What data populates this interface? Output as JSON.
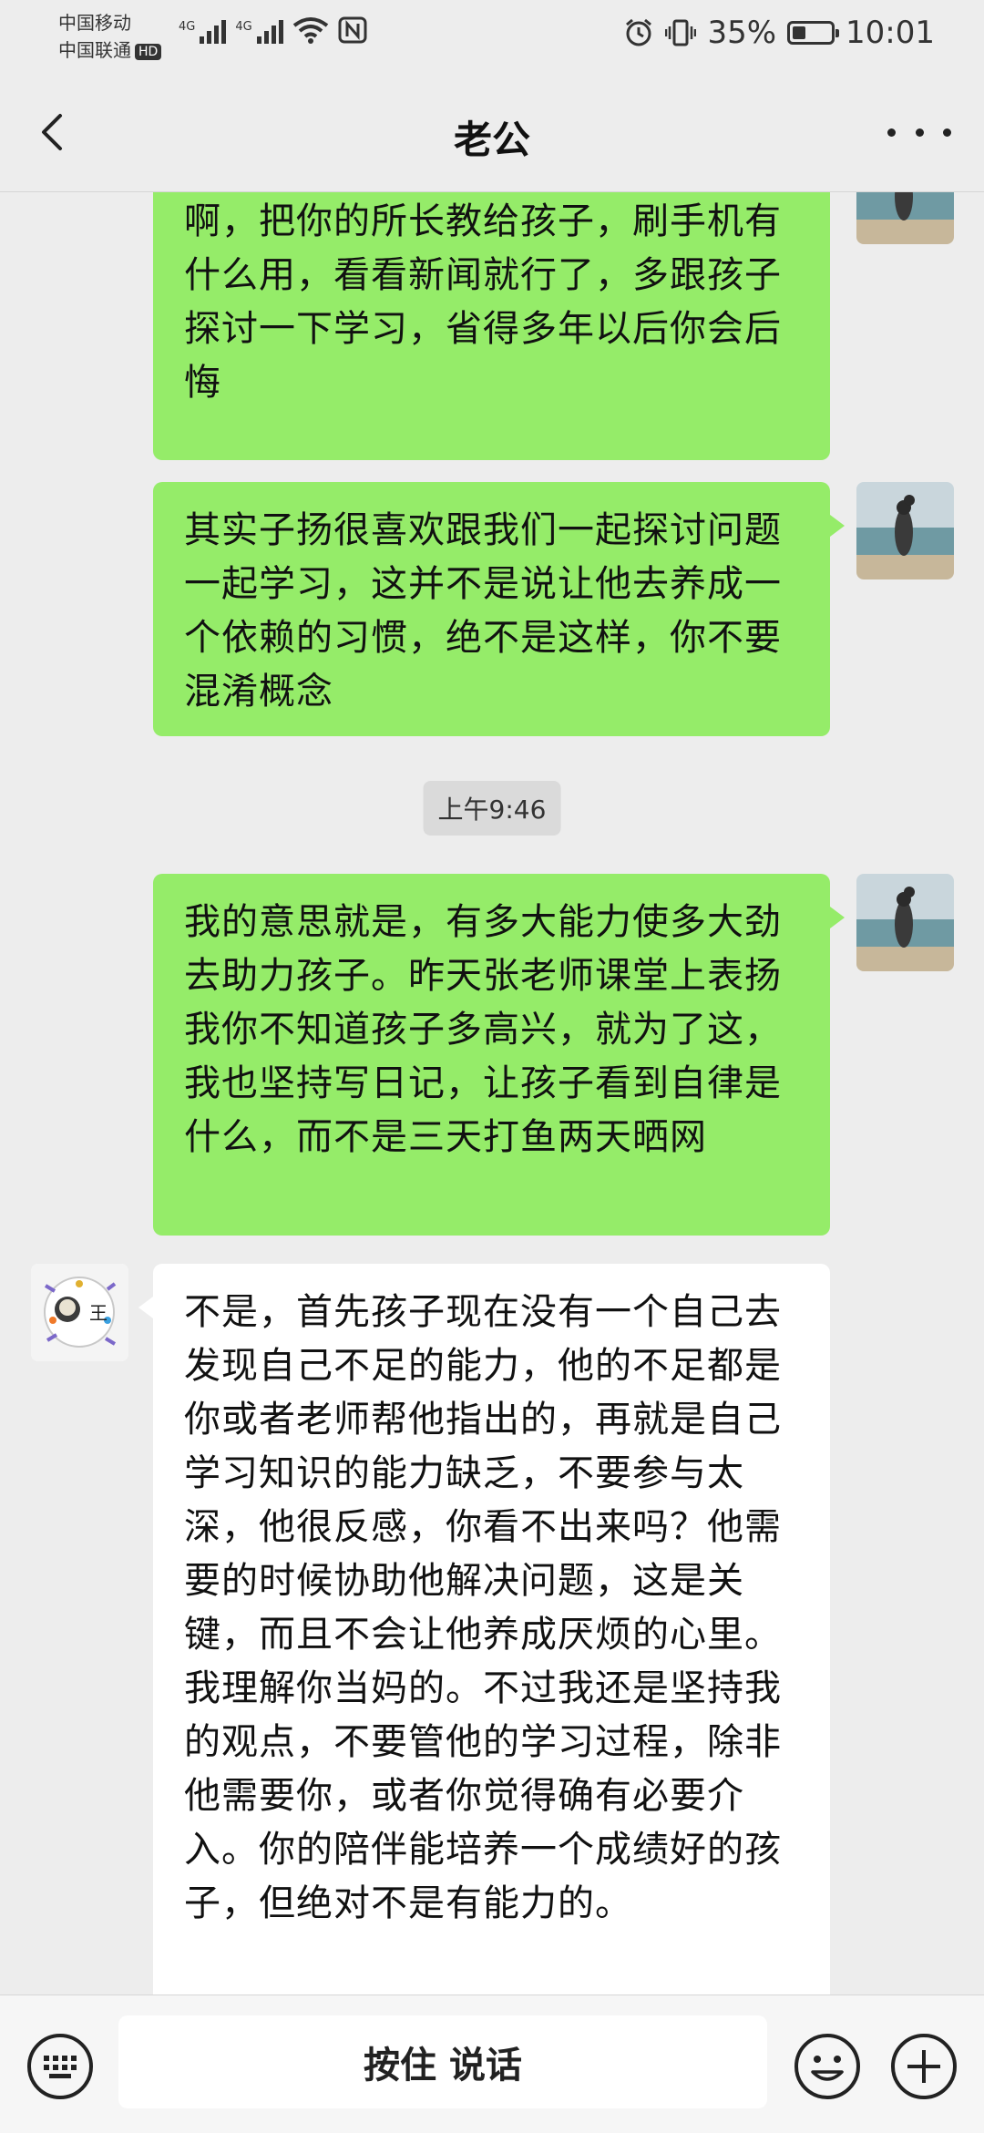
{
  "status": {
    "carrier1": "中国移动",
    "carrier2": "中国联通",
    "hd": "HD",
    "net1": "4G",
    "net2": "4G",
    "battery": "35%",
    "battery_level": 0.35,
    "time": "10:01"
  },
  "nav": {
    "title": "老公"
  },
  "messages": [
    {
      "text": "你哪怕去教他一些好的学习方法也行啊，把你的所长教给孩子，刷手机有什么用，看看新闻就行了，多跟孩子探讨一下学习，省得多年以后你会后悔"
    },
    {
      "text": "其实子扬很喜欢跟我们一起探讨问题一起学习，这并不是说让他去养成一个依赖的习惯，绝不是这样，你不要混淆概念"
    },
    {
      "timestamp": "上午9:46"
    },
    {
      "text": "我的意思就是，有多大能力使多大劲去助力孩子。昨天张老师课堂上表扬我你不知道孩子多高兴，就为了这，我也坚持写日记，让孩子看到自律是什么，而不是三天打鱼两天晒网"
    },
    {
      "text": "不是，首先孩子现在没有一个自己去发现自己不足的能力，他的不足都是你或者老师帮他指出的，再就是自己学习知识的能力缺乏，不要参与太深，他很反感，你看不出来吗？他需要的时候协助他解决问题，这是关键，而且不会让他养成厌烦的心里。我理解你当妈的。不过我还是坚持我的观点，不要管他的学习过程，除非他需要你，或者你觉得确有必要介入。你的陪伴能培养一个成绩好的孩子，但绝对不是有能力的。"
    }
  ],
  "avatar_them_char": "王",
  "input": {
    "voice_label": "按住 说话"
  }
}
